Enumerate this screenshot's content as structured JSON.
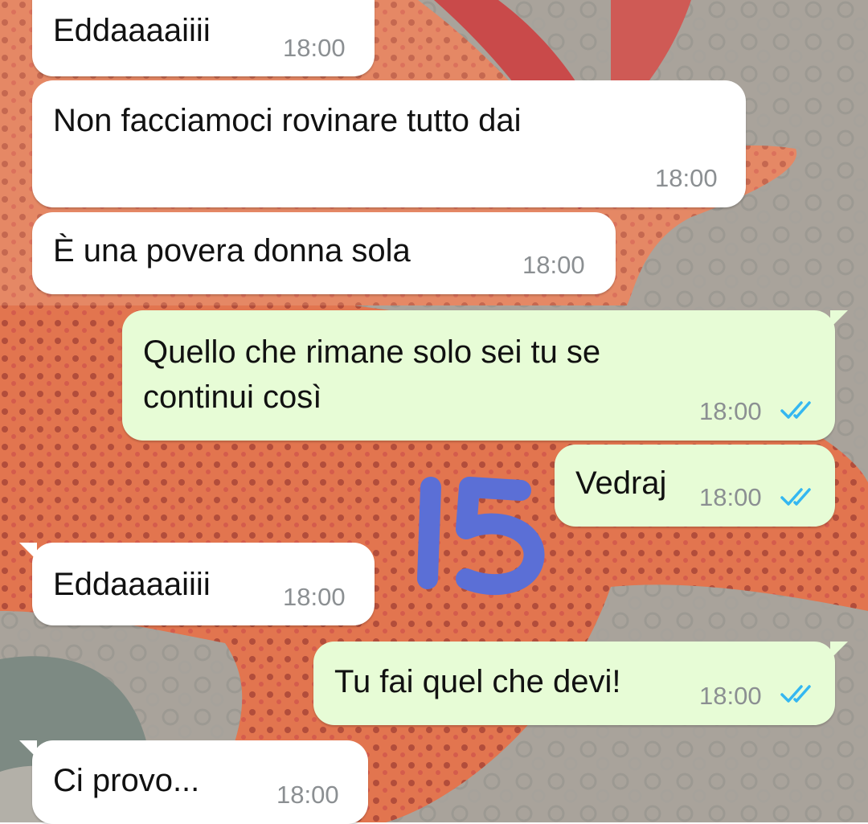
{
  "messages": [
    {
      "direction": "incoming",
      "text": "Eddaaaaiiii",
      "time": "18:00"
    },
    {
      "direction": "incoming",
      "text": "Non facciamoci rovinare tutto dai",
      "time": "18:00"
    },
    {
      "direction": "incoming",
      "text": "È una povera donna sola",
      "time": "18:00"
    },
    {
      "direction": "outgoing",
      "text": "Quello che rimane solo sei tu se\ncontinui così",
      "time": "18:00",
      "status": "read"
    },
    {
      "direction": "outgoing",
      "text": "Vedraj",
      "time": "18:00",
      "status": "read"
    },
    {
      "direction": "incoming",
      "text": "Eddaaaaiiii",
      "time": "18:00"
    },
    {
      "direction": "outgoing",
      "text": "Tu fai quel che devi!",
      "time": "18:00",
      "status": "read"
    },
    {
      "direction": "incoming",
      "text": "Ci provo...",
      "time": "18:00"
    }
  ],
  "overlay": {
    "text": "15",
    "color": "#5b6fd6"
  },
  "colors": {
    "incoming_bubble": "#ffffff",
    "outgoing_bubble": "#e7fcd6",
    "read_ticks": "#34b7f1",
    "timestamp": "#8b8f92"
  },
  "wallpaper": {
    "description_icon": "starfish-wallpaper"
  }
}
